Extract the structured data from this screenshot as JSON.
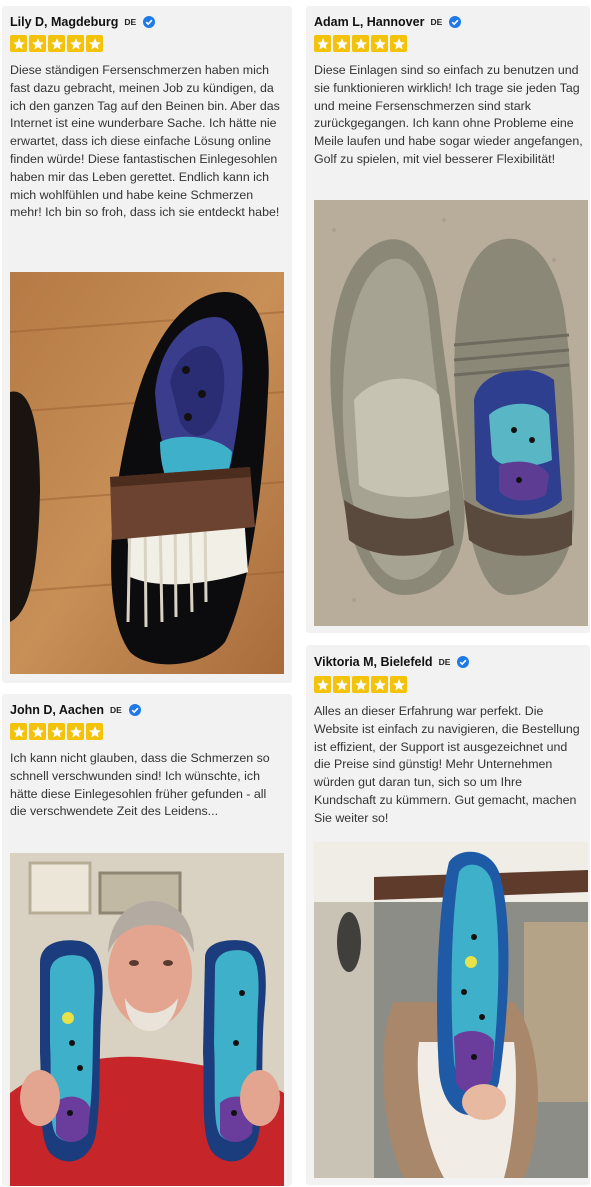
{
  "colors": {
    "card_bg": "#f2f2f2",
    "star": "#f3c30c",
    "verified": "#1e7ae6"
  },
  "reviews": [
    {
      "name": "Lily D, Magdeburg",
      "country": "DE",
      "rating": 5,
      "verified": true,
      "text": "Diese ständigen Fersenschmerzen haben mich fast dazu gebracht, meinen Job zu kündigen, da ich den ganzen Tag auf den Beinen bin. Aber das Internet ist eine wunderbare Sache. Ich hätte nie erwartet, dass ich diese einfache Lösung online finden würde! Diese fantastischen Einlegesohlen haben mir das Leben gerettet. Endlich kann ich mich wohlfühlen und habe keine Schmerzen mehr! Ich bin so froh, dass ich sie entdeckt habe!"
    },
    {
      "name": "Adam L, Hannover",
      "country": "DE",
      "rating": 5,
      "verified": true,
      "text": "Diese Einlagen sind so einfach zu benutzen und sie funktionieren wirklich! Ich trage sie jeden Tag und meine Fersenschmerzen sind stark zurückgegangen. Ich kann ohne Probleme eine Meile laufen und habe sogar wieder angefangen, Golf zu spielen, mit viel besserer Flexibilität!"
    },
    {
      "name": "John D, Aachen",
      "country": "DE",
      "rating": 5,
      "verified": true,
      "text": "Ich kann nicht glauben, dass die Schmerzen so schnell verschwunden sind! Ich wünschte, ich hätte diese Einlegesohlen früher gefunden - all die verschwendete Zeit des Leidens..."
    },
    {
      "name": "Viktoria M, Bielefeld",
      "country": "DE",
      "rating": 5,
      "verified": true,
      "text": "Alles an dieser Erfahrung war perfekt. Die Website ist einfach zu navigieren, die Bestellung ist effizient, der Support ist ausgezeichnet und die Preise sind günstig! Mehr Unternehmen würden gut daran tun, sich so um Ihre Kundschaft zu kümmern. Gut gemacht, machen Sie weiter so!"
    }
  ]
}
